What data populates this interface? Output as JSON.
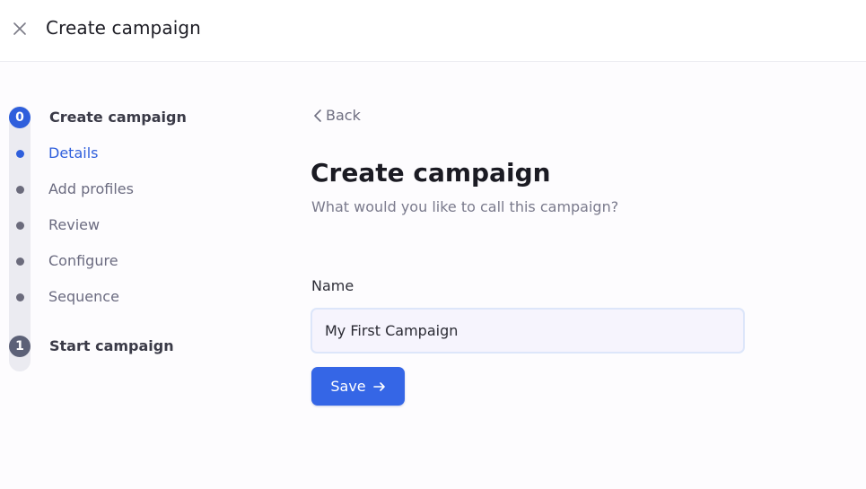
{
  "header": {
    "title": "Create campaign",
    "close_icon": "close-icon"
  },
  "stepper": {
    "steps": [
      {
        "number": "0",
        "title": "Create campaign",
        "active": true,
        "substeps": [
          {
            "label": "Details",
            "active": true
          },
          {
            "label": "Add profiles",
            "active": false
          },
          {
            "label": "Review",
            "active": false
          },
          {
            "label": "Configure",
            "active": false
          },
          {
            "label": "Sequence",
            "active": false
          }
        ]
      },
      {
        "number": "1",
        "title": "Start campaign",
        "active": false,
        "substeps": []
      }
    ]
  },
  "main": {
    "back_label": "Back",
    "back_icon": "chevron-left-icon",
    "title": "Create campaign",
    "subtitle": "What would you like to call this campaign?",
    "name_field": {
      "label": "Name",
      "value": "My First Campaign"
    },
    "save_button": {
      "label": "Save",
      "icon": "arrow-right-icon"
    }
  },
  "colors": {
    "accent": "#3566e6",
    "active_step": "#2f5fdc",
    "inactive_step": "#5c6177",
    "muted_text": "#6b6b80"
  }
}
